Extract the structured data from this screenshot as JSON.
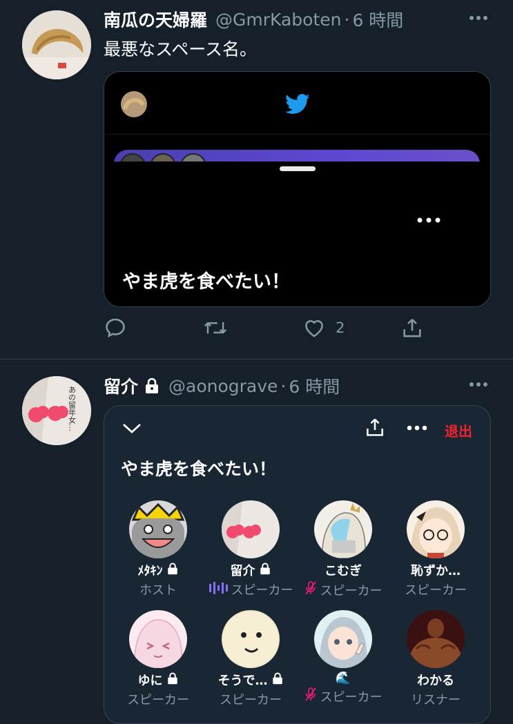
{
  "tweets": [
    {
      "name": "南瓜の天婦羅",
      "handle": "@GmrKaboten",
      "dot": "·",
      "time": "6 時間",
      "text": "最悪なスペース名。",
      "card": {
        "title": "やま虎を食べたい！"
      },
      "likes": "2"
    },
    {
      "name": "留介",
      "handle": "@aonograve",
      "dot": "·",
      "time": "6 時間",
      "avatar_text": "あの留年女…",
      "space": {
        "leave_label": "退出",
        "title": "やま虎を食べたい！",
        "people": [
          {
            "name": "ﾒﾀｷﾝ",
            "role": "ホスト",
            "lock": true
          },
          {
            "name": "留介",
            "role": "スピーカー",
            "lock": true,
            "indicator": "speaking"
          },
          {
            "name": "こむぎ",
            "role": "スピーカー",
            "indicator": "muted"
          },
          {
            "name": "恥ずか…",
            "role": "スピーカー"
          },
          {
            "name": "ゆに",
            "role": "スピーカー",
            "lock": true
          },
          {
            "name": "そうで…",
            "role": "スピーカー",
            "lock": true
          },
          {
            "name": "🌊",
            "role": "スピーカー",
            "indicator": "muted"
          },
          {
            "name": "わかる",
            "role": "リスナー"
          }
        ]
      }
    }
  ],
  "colors": {
    "bg": "#15202b",
    "accent": "#1d9bf0",
    "muted": "#8899a6",
    "danger": "#f4212e",
    "speaking": "#8b6cf6",
    "mute": "#f91880"
  }
}
